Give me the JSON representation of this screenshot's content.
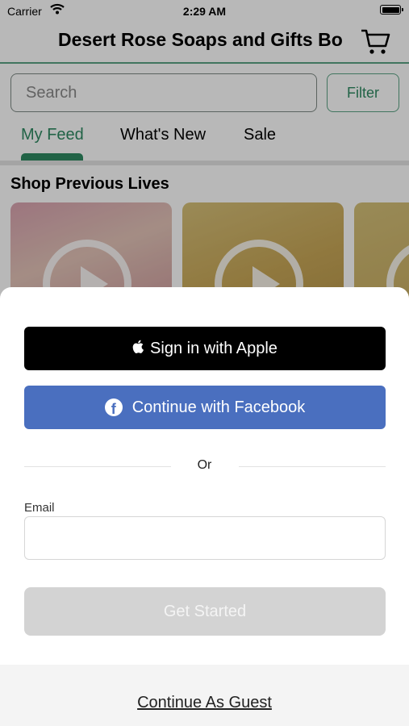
{
  "status_bar": {
    "carrier": "Carrier",
    "time": "2:29 AM"
  },
  "header": {
    "title": "Desert Rose Soaps and Gifts Bo"
  },
  "search": {
    "placeholder": "Search",
    "value": ""
  },
  "filter_label": "Filter",
  "tabs": [
    {
      "label": "My Feed",
      "active": true
    },
    {
      "label": "What's New"
    },
    {
      "label": "Sale"
    }
  ],
  "section_title": "Shop Previous Lives",
  "sheet": {
    "apple_label": "Sign in with Apple",
    "facebook_label": "Continue with Facebook",
    "or_text": "Or",
    "email_label": "Email",
    "email_value": "",
    "get_started_label": "Get Started",
    "guest_label": "Continue As Guest"
  },
  "colors": {
    "accent": "#2f8a62",
    "facebook": "#4a6fbf",
    "disabled_button": "#d3d3d3"
  },
  "icons": [
    "wifi-icon",
    "battery-icon",
    "cart-icon",
    "play-icon",
    "apple-icon",
    "facebook-icon"
  ]
}
